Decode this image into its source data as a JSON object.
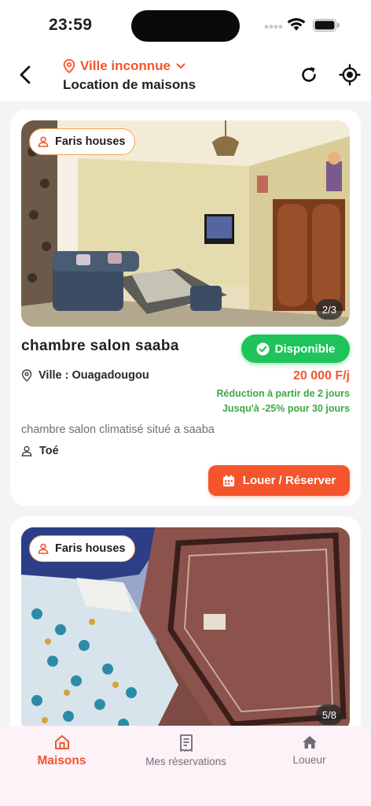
{
  "status_bar": {
    "time": "23:59"
  },
  "header": {
    "city": "Ville inconnue",
    "title": "Location de maisons"
  },
  "listings": [
    {
      "owner": "Faris houses",
      "photo_counter": "2/3",
      "title": "chambre salon saaba",
      "availability": "Disponible",
      "city_line": "Ville : Ouagadougou",
      "price": "20 000 F/j",
      "promo_line1": "Réduction à partir de 2 jours",
      "promo_line2": "Jusqu'à -25% pour 30 jours",
      "description": "chambre salon climatisé situé a saaba",
      "host": "Toé",
      "book_label": "Louer / Réserver"
    },
    {
      "owner": "Faris houses",
      "photo_counter": "5/8"
    }
  ],
  "tabs": [
    {
      "label": "Maisons",
      "icon": "home-icon",
      "active": true
    },
    {
      "label": "Mes réservations",
      "icon": "receipt-icon",
      "active": false
    },
    {
      "label": "Loueur",
      "icon": "house-icon",
      "active": false
    }
  ],
  "colors": {
    "accent": "#f4552c",
    "available": "#1ec45a",
    "promo": "#3ea745",
    "tabbar_bg": "#fdf2f7"
  }
}
